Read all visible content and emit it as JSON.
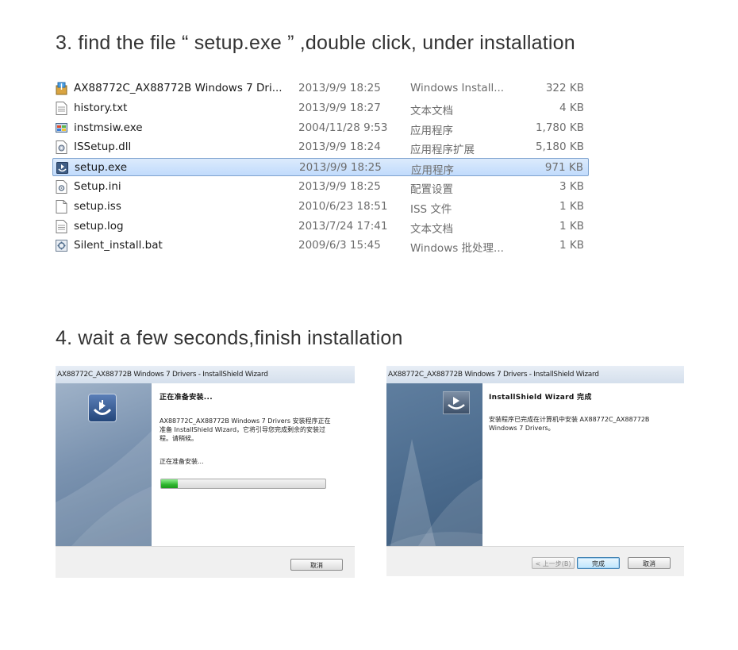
{
  "step3": {
    "title": "3. find the file  “ setup.exe ” ,double click, under installation"
  },
  "files": [
    {
      "name": "AX88772C_AX88772B Windows 7 Dri...",
      "date": "2013/9/9 18:25",
      "type": "Windows Install...",
      "size": "322 KB",
      "icon": "installer-package-icon",
      "selected": false
    },
    {
      "name": "history.txt",
      "date": "2013/9/9 18:27",
      "type": "文本文档",
      "size": "4 KB",
      "icon": "text-file-icon",
      "selected": false
    },
    {
      "name": "instmsiw.exe",
      "date": "2004/11/28 9:53",
      "type": "应用程序",
      "size": "1,780 KB",
      "icon": "windows-installer-exe-icon",
      "selected": false
    },
    {
      "name": "ISSetup.dll",
      "date": "2013/9/9 18:24",
      "type": "应用程序扩展",
      "size": "5,180 KB",
      "icon": "dll-file-icon",
      "selected": false
    },
    {
      "name": "setup.exe",
      "date": "2013/9/9 18:25",
      "type": "应用程序",
      "size": "971 KB",
      "icon": "setup-exe-icon",
      "selected": true
    },
    {
      "name": "Setup.ini",
      "date": "2013/9/9 18:25",
      "type": "配置设置",
      "size": "3 KB",
      "icon": "config-file-icon",
      "selected": false
    },
    {
      "name": "setup.iss",
      "date": "2010/6/23 18:51",
      "type": "ISS 文件",
      "size": "1 KB",
      "icon": "blank-file-icon",
      "selected": false
    },
    {
      "name": "setup.log",
      "date": "2013/7/24 17:41",
      "type": "文本文档",
      "size": "1 KB",
      "icon": "text-file-icon",
      "selected": false
    },
    {
      "name": "Silent_install.bat",
      "date": "2009/6/3 15:45",
      "type": "Windows 批处理...",
      "size": "1 KB",
      "icon": "batch-file-icon",
      "selected": false
    }
  ],
  "step4": {
    "title": "4. wait a few seconds,finish installation"
  },
  "wizard1": {
    "title": "AX88772C_AX88772B Windows 7 Drivers - InstallShield Wizard",
    "heading": "正在准备安装...",
    "body": "AX88772C_AX88772B Windows 7 Drivers 安装程序正在准备 InstallShield Wizard，它将引导您完成剩余的安装过程。请稍候。",
    "status": "正在准备安装...",
    "progress": 0.1,
    "cancel_label": "取消"
  },
  "wizard2": {
    "title": "AX88772C_AX88772B Windows 7 Drivers - InstallShield Wizard",
    "heading": "InstallShield Wizard 完成",
    "body": "安装程序已完成在计算机中安装 AX88772C_AX88772B Windows 7 Drivers。",
    "back_label": "< 上一步(B)",
    "finish_label": "完成",
    "cancel_label": "取消"
  },
  "colors": {
    "selection": "#c1dbfc",
    "selection_border": "#7da2ce",
    "progress": "#2fb52f"
  }
}
